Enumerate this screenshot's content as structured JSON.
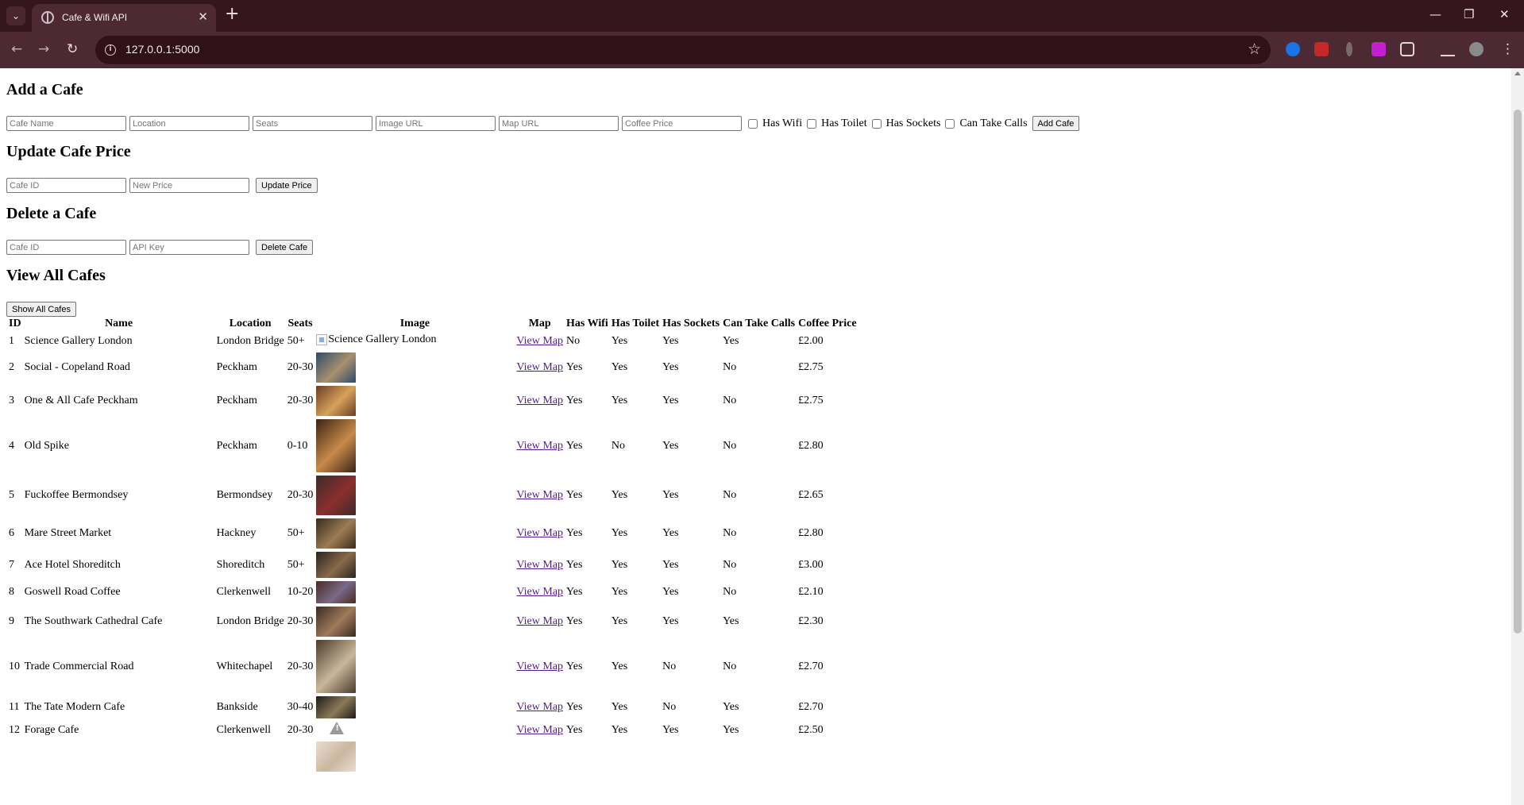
{
  "browser": {
    "tab_title": "Cafe & Wifi API",
    "url": "127.0.0.1:5000"
  },
  "add_form": {
    "heading": "Add a Cafe",
    "placeholders": {
      "name": "Cafe Name",
      "location": "Location",
      "seats": "Seats",
      "img_url": "Image URL",
      "map_url": "Map URL",
      "coffee_price": "Coffee Price"
    },
    "checkboxes": {
      "has_wifi": "Has Wifi",
      "has_toilet": "Has Toilet",
      "has_sockets": "Has Sockets",
      "can_take_calls": "Can Take Calls"
    },
    "button": "Add Cafe"
  },
  "update_form": {
    "heading": "Update Cafe Price",
    "placeholders": {
      "cafe_id": "Cafe ID",
      "new_price": "New Price"
    },
    "button": "Update Price"
  },
  "delete_form": {
    "heading": "Delete a Cafe",
    "placeholders": {
      "cafe_id": "Cafe ID",
      "api_key": "API Key"
    },
    "button": "Delete Cafe"
  },
  "view": {
    "heading": "View All Cafes",
    "button": "Show All Cafes",
    "columns": [
      "ID",
      "Name",
      "Location",
      "Seats",
      "Image",
      "Map",
      "Has Wifi",
      "Has Toilet",
      "Has Sockets",
      "Can Take Calls",
      "Coffee Price"
    ],
    "map_link_text": "View Map",
    "rows": [
      {
        "id": "1",
        "name": "Science Gallery London",
        "location": "London Bridge",
        "seats": "50+",
        "image": {
          "kind": "broken",
          "alt": "Science Gallery London"
        },
        "wifi": "No",
        "toilet": "Yes",
        "sockets": "Yes",
        "calls": "Yes",
        "price": "£2.00"
      },
      {
        "id": "2",
        "name": "Social - Copeland Road",
        "location": "Peckham",
        "seats": "20-30",
        "image": {
          "kind": "photo",
          "colors": [
            "#2f4a66",
            "#a7916e"
          ],
          "ratio": 0.75
        },
        "wifi": "Yes",
        "toilet": "Yes",
        "sockets": "Yes",
        "calls": "No",
        "price": "£2.75"
      },
      {
        "id": "3",
        "name": "One & All Cafe Peckham",
        "location": "Peckham",
        "seats": "20-30",
        "image": {
          "kind": "photo",
          "colors": [
            "#6b3d24",
            "#d6a15a"
          ],
          "ratio": 0.75
        },
        "wifi": "Yes",
        "toilet": "Yes",
        "sockets": "Yes",
        "calls": "No",
        "price": "£2.75"
      },
      {
        "id": "4",
        "name": "Old Spike",
        "location": "Peckham",
        "seats": "0-10",
        "image": {
          "kind": "photo",
          "colors": [
            "#3a2415",
            "#c98a4a"
          ],
          "ratio": 1.33
        },
        "wifi": "Yes",
        "toilet": "No",
        "sockets": "Yes",
        "calls": "No",
        "price": "£2.80"
      },
      {
        "id": "5",
        "name": "Fuckoffee Bermondsey",
        "location": "Bermondsey",
        "seats": "20-30",
        "image": {
          "kind": "photo",
          "colors": [
            "#3c2b2a",
            "#8a2f2f"
          ],
          "ratio": 1.0
        },
        "wifi": "Yes",
        "toilet": "Yes",
        "sockets": "Yes",
        "calls": "No",
        "price": "£2.65"
      },
      {
        "id": "6",
        "name": "Mare Street Market",
        "location": "Hackney",
        "seats": "50+",
        "image": {
          "kind": "photo",
          "colors": [
            "#3b2a1c",
            "#9c7c55"
          ],
          "ratio": 0.75
        },
        "wifi": "Yes",
        "toilet": "Yes",
        "sockets": "Yes",
        "calls": "No",
        "price": "£2.80"
      },
      {
        "id": "7",
        "name": "Ace Hotel Shoreditch",
        "location": "Shoreditch",
        "seats": "50+",
        "image": {
          "kind": "photo",
          "colors": [
            "#2a2420",
            "#8a6a4a"
          ],
          "ratio": 0.66
        },
        "wifi": "Yes",
        "toilet": "Yes",
        "sockets": "Yes",
        "calls": "No",
        "price": "£3.00"
      },
      {
        "id": "8",
        "name": "Goswell Road Coffee",
        "location": "Clerkenwell",
        "seats": "10-20",
        "image": {
          "kind": "photo",
          "colors": [
            "#4a2a22",
            "#7a6a88"
          ],
          "ratio": 0.56
        },
        "wifi": "Yes",
        "toilet": "Yes",
        "sockets": "Yes",
        "calls": "No",
        "price": "£2.10"
      },
      {
        "id": "9",
        "name": "The Southwark Cathedral Cafe",
        "location": "London Bridge",
        "seats": "20-30",
        "image": {
          "kind": "photo",
          "colors": [
            "#3a2a22",
            "#a07a5a"
          ],
          "ratio": 0.75
        },
        "wifi": "Yes",
        "toilet": "Yes",
        "sockets": "Yes",
        "calls": "Yes",
        "price": "£2.30"
      },
      {
        "id": "10",
        "name": "Trade Commercial Road",
        "location": "Whitechapel",
        "seats": "20-30",
        "image": {
          "kind": "photo",
          "colors": [
            "#4a3a2c",
            "#c9b79a"
          ],
          "ratio": 1.33
        },
        "wifi": "Yes",
        "toilet": "Yes",
        "sockets": "No",
        "calls": "No",
        "price": "£2.70"
      },
      {
        "id": "11",
        "name": "The Tate Modern Cafe",
        "location": "Bankside",
        "seats": "30-40",
        "image": {
          "kind": "photo",
          "colors": [
            "#1f1a16",
            "#8a7a5a"
          ],
          "ratio": 0.56
        },
        "wifi": "Yes",
        "toilet": "Yes",
        "sockets": "No",
        "calls": "Yes",
        "price": "£2.70"
      },
      {
        "id": "12",
        "name": "Forage Cafe",
        "location": "Clerkenwell",
        "seats": "20-30",
        "image": {
          "kind": "warning"
        },
        "wifi": "Yes",
        "toilet": "Yes",
        "sockets": "Yes",
        "calls": "Yes",
        "price": "£2.50"
      },
      {
        "id": "",
        "name": "",
        "location": "",
        "seats": "",
        "image": {
          "kind": "photo",
          "colors": [
            "#e9ddd0",
            "#cbb79f"
          ],
          "ratio": 0.75
        },
        "wifi": "",
        "toilet": "",
        "sockets": "",
        "calls": "",
        "price": ""
      }
    ]
  }
}
